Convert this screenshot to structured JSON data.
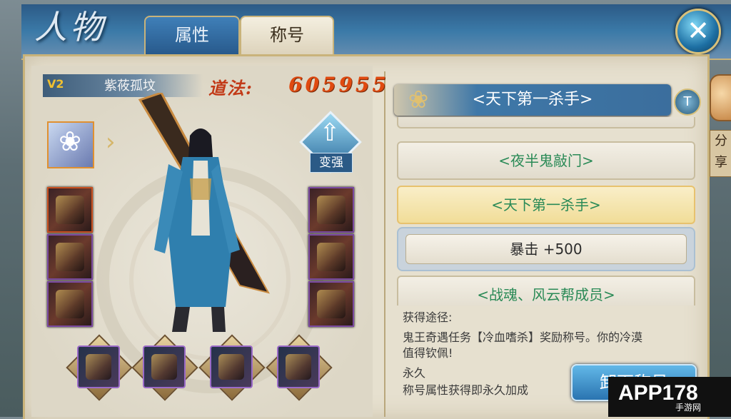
{
  "header": {
    "title": "人物",
    "tabs": [
      {
        "label": "属性",
        "active": false
      },
      {
        "label": "称号",
        "active": true
      }
    ],
    "close_icon": "close-icon"
  },
  "character": {
    "vip": "V2",
    "name": "紫莜孤坟",
    "daofa_label": "道法:",
    "daofa_value": "605955",
    "upgrade_label": "变强"
  },
  "equipment": {
    "left_slots": [
      "weapon-icon",
      "gauntlet-icon",
      "boots-icon"
    ],
    "right_slots": [
      "helmet-icon",
      "armor-icon",
      "belt-icon"
    ],
    "bottom_slots": [
      "ring-icon",
      "necklace-icon",
      "pendant-icon",
      "amulet-icon"
    ]
  },
  "titles": {
    "current": "<天下第一杀手>",
    "list": [
      {
        "label": "<天下第一杀手>",
        "selected": false,
        "partial": true
      },
      {
        "label": "<夜半鬼敲门>",
        "selected": false
      },
      {
        "label": "<天下第一杀手>",
        "selected": true
      },
      {
        "detail": "暴击 +500"
      },
      {
        "label": "<战魂、风云帮成员>",
        "selected": false
      }
    ],
    "source_label": "获得途径:",
    "source_text_1": "鬼王奇遇任务【冷血嗜杀】奖励称号。你的冷漠",
    "source_text_2": "值得钦佩!",
    "duration": "永久",
    "permanent_note": "称号属性获得即永久加成",
    "unequip_label": "卸下称号"
  },
  "share": {
    "label": "分享"
  },
  "watermark": {
    "logo": "APP178",
    "sub": "手游网"
  },
  "colors": {
    "title_green": "#2a8a56",
    "daofa_red": "#c23a18",
    "header_blue": "#3b7aa8",
    "parchment": "#e6e0cf",
    "gold_border": "#c9b37a"
  }
}
